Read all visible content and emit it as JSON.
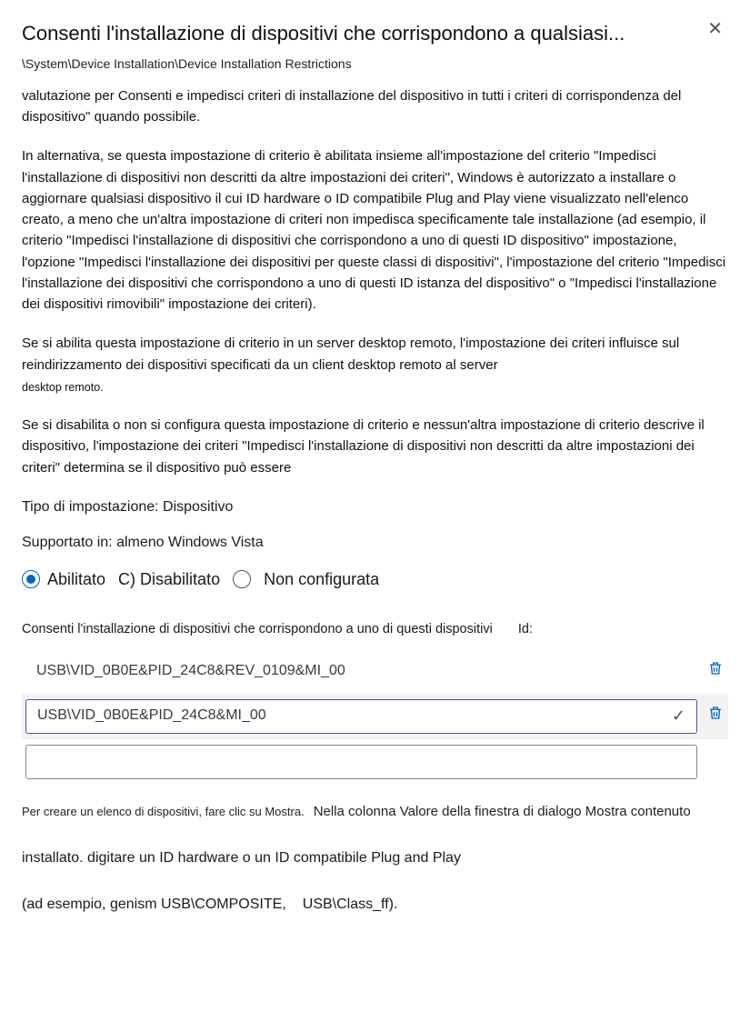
{
  "header": {
    "title": "Consenti l'installazione di dispositivi che corrispondono a qualsiasi...",
    "breadcrumb": "\\System\\Device Installation\\Device Installation Restrictions"
  },
  "description": {
    "p0": "valutazione per Consenti e impedisci criteri di installazione del dispositivo in tutti i criteri di corrispondenza del dispositivo\" quando possibile.",
    "p1": "In alternativa, se questa impostazione di criterio è abilitata insieme all'impostazione del criterio \"Impedisci l'installazione di dispositivi non descritti da altre impostazioni dei criteri\", Windows è autorizzato a installare o aggiornare qualsiasi dispositivo il cui ID hardware o ID compatibile Plug and Play viene visualizzato nell'elenco creato, a meno che un'altra impostazione di criteri non impedisca specificamente tale installazione (ad esempio, il criterio \"Impedisci l'installazione di dispositivi che corrispondono a uno di questi ID dispositivo\" impostazione, l'opzione \"Impedisci l'installazione dei dispositivi per queste classi di dispositivi\", l'impostazione del criterio \"Impedisci l'installazione dei dispositivi che corrispondono a uno di questi ID istanza del dispositivo\" o \"Impedisci l'installazione dei dispositivi rimovibili\" impostazione dei criteri).",
    "p2": "Se si abilita questa impostazione di criterio in un server desktop remoto, l'impostazione dei criteri influisce sul reindirizzamento dei dispositivi specificati da un client desktop remoto al server",
    "p2b": "desktop remoto.",
    "p3": "Se si disabilita o non si configura questa impostazione di criterio e nessun'altra impostazione di criterio descrive il dispositivo, l'impostazione dei criteri \"Impedisci l'installazione di dispositivi non descritti da altre impostazioni dei criteri\" determina se il dispositivo può essere"
  },
  "meta": {
    "setting_type": "Tipo di impostazione: Dispositivo",
    "supported": "Supportato in: almeno Windows Vista"
  },
  "radios": {
    "enabled": "Abilitato",
    "disabled": "C) Disabilitato",
    "not_configured": "Non configurata"
  },
  "list": {
    "label": "Consenti l'installazione di dispositivi che corrispondono a uno di questi dispositivi",
    "label_col": "Id:",
    "rows": [
      {
        "value": "USB\\VID_0B0E&PID_24C8&REV_0109&MI_00",
        "selected": false
      },
      {
        "value": "USB\\VID_0B0E&PID_24C8&MI_00",
        "selected": true
      },
      {
        "value": "",
        "selected": false
      }
    ]
  },
  "footnote": {
    "a": "Per creare un elenco di dispositivi, fare clic su Mostra.",
    "b": "Nella colonna Valore della finestra di dialogo Mostra contenuto",
    "c": "installato. digitare un ID hardware o un ID compatibile Plug and Play",
    "d1": "(ad esempio, genism USB\\COMPOSITE,",
    "d2": "USB\\Class_ff)."
  }
}
